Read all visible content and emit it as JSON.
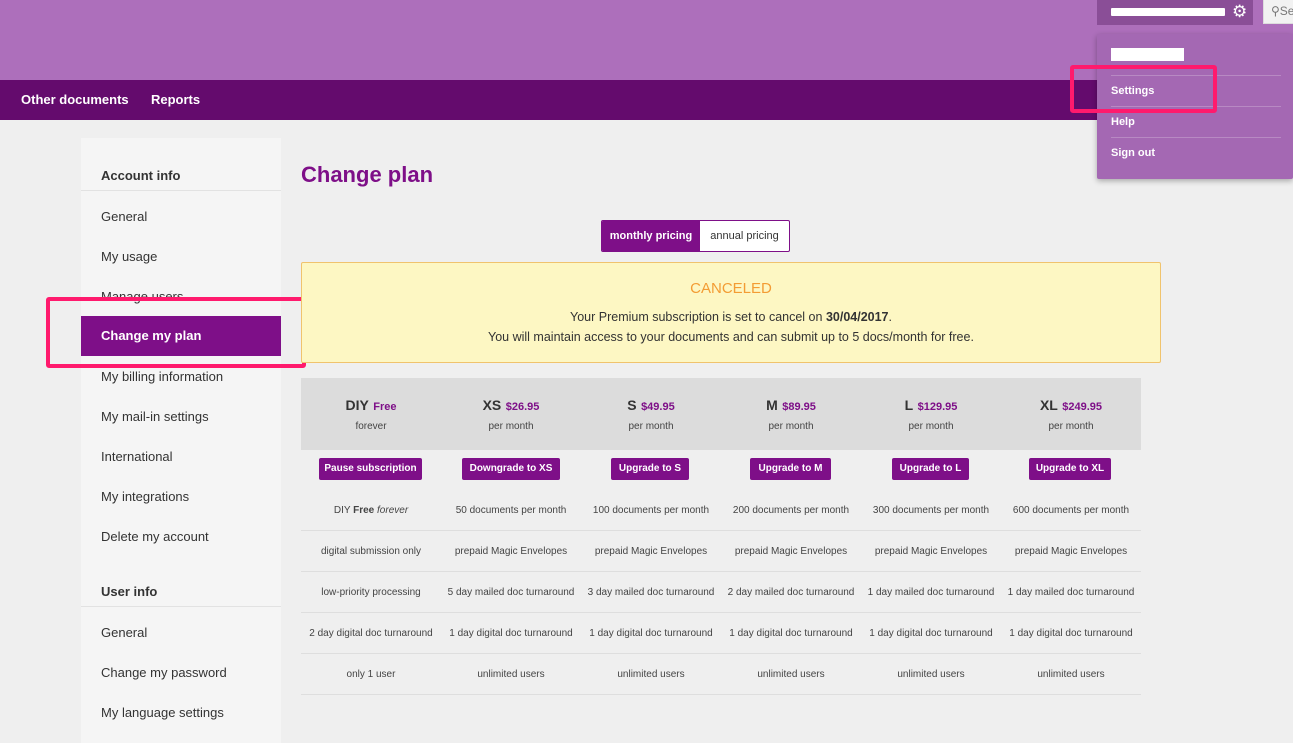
{
  "nav": {
    "links": [
      "Other documents",
      "Reports"
    ]
  },
  "header": {
    "search_placeholder": "Se"
  },
  "user_menu": {
    "items": [
      "Settings",
      "Help",
      "Sign out"
    ]
  },
  "sidebar": {
    "account_heading": "Account info",
    "account_items": [
      "General",
      "My usage",
      "Manage users",
      "Change my plan",
      "My billing information",
      "My mail-in settings",
      "International",
      "My integrations",
      "Delete my account"
    ],
    "user_heading": "User info",
    "user_items": [
      "General",
      "Change my password",
      "My language settings"
    ]
  },
  "page": {
    "title": "Change plan"
  },
  "pricing_toggle": {
    "monthly": "monthly pricing",
    "annual": "annual pricing"
  },
  "notice": {
    "title": "CANCELED",
    "line1_pre": "Your Premium subscription is set to cancel on ",
    "line1_date": "30/04/2017",
    "line1_post": ".",
    "line2": "You will maintain access to your documents and can submit up to 5 docs/month for free."
  },
  "plans": [
    {
      "name": "DIY",
      "price": "Free",
      "period": "forever",
      "button": "Pause subscription"
    },
    {
      "name": "XS",
      "price": "$26.95",
      "period": "per month",
      "button": "Downgrade to XS"
    },
    {
      "name": "S",
      "price": "$49.95",
      "period": "per month",
      "button": "Upgrade to S"
    },
    {
      "name": "M",
      "price": "$89.95",
      "period": "per month",
      "button": "Upgrade to M"
    },
    {
      "name": "L",
      "price": "$129.95",
      "period": "per month",
      "button": "Upgrade to L"
    },
    {
      "name": "XL",
      "price": "$249.95",
      "period": "per month",
      "button": "Upgrade to XL"
    }
  ],
  "features": {
    "diy_first": {
      "name": "DIY",
      "free": "Free",
      "forever": "forever"
    },
    "row1": [
      "50 documents per month",
      "100 documents per month",
      "200 documents per month",
      "300 documents per month",
      "600 documents per month"
    ],
    "row2": [
      "digital submission only",
      "prepaid Magic Envelopes",
      "prepaid Magic Envelopes",
      "prepaid Magic Envelopes",
      "prepaid Magic Envelopes",
      "prepaid Magic Envelopes"
    ],
    "row3": [
      "low-priority processing",
      "5 day mailed doc turnaround",
      "3 day mailed doc turnaround",
      "2 day mailed doc turnaround",
      "1 day mailed doc turnaround",
      "1 day mailed doc turnaround"
    ],
    "row4": [
      "2 day digital doc turnaround",
      "1 day digital doc turnaround",
      "1 day digital doc turnaround",
      "1 day digital doc turnaround",
      "1 day digital doc turnaround",
      "1 day digital doc turnaround"
    ],
    "row5": [
      "only 1 user",
      "unlimited users",
      "unlimited users",
      "unlimited users",
      "unlimited users",
      "unlimited users"
    ]
  },
  "colors": {
    "brand": "#7e0f88",
    "nav": "#640b6d",
    "header": "#ad6fbb",
    "highlight": "#ff1a6d",
    "notice_title": "#f39c34"
  }
}
